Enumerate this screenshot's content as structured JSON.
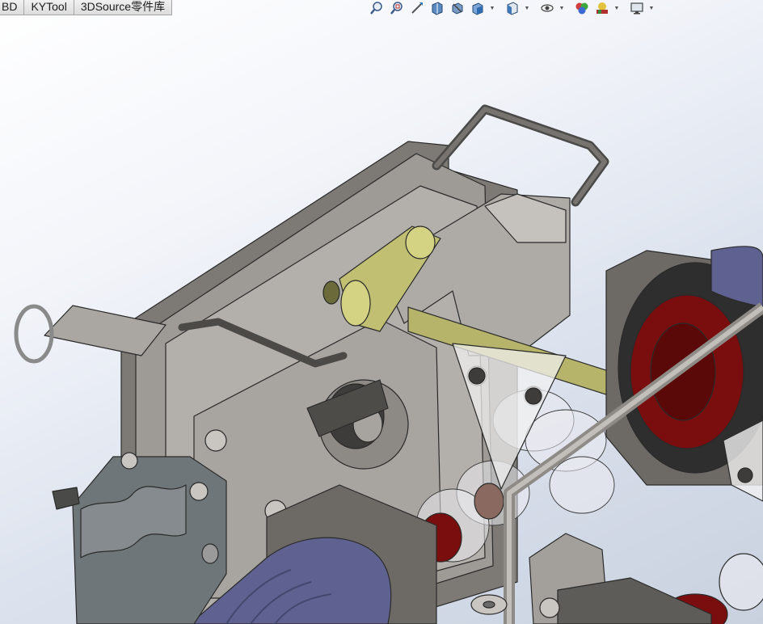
{
  "tabs": [
    {
      "label": "BD"
    },
    {
      "label": "KYTool"
    },
    {
      "label": "3DSource零件库"
    }
  ],
  "heads_up_toolbar": [
    {
      "icon": "zoom-to-fit-icon"
    },
    {
      "icon": "zoom-to-area-icon"
    },
    {
      "icon": "previous-view-icon"
    },
    {
      "icon": "section-view-icon"
    },
    {
      "icon": "dynamic-annotation-views-icon"
    },
    {
      "icon": "view-orientation-icon",
      "dropdown": true
    },
    {
      "icon": "display-style-icon",
      "dropdown": true
    },
    {
      "icon": "hide-show-items-icon",
      "dropdown": true
    },
    {
      "icon": "edit-appearance-icon"
    },
    {
      "icon": "apply-scene-icon",
      "dropdown": true
    },
    {
      "icon": "view-settings-icon",
      "dropdown": true
    }
  ],
  "colors": {
    "background_top": "#ffffff",
    "background_bottom": "#c9d1df",
    "frame_grey": "#8e8b86",
    "plate_grey": "#a3a09b",
    "dark_grey": "#5e5c58",
    "link_yellow": "#b6b46a",
    "insulator_blue": "#5f6290",
    "contact_red": "#7a0d0d",
    "cover_slate": "#6f7679"
  }
}
